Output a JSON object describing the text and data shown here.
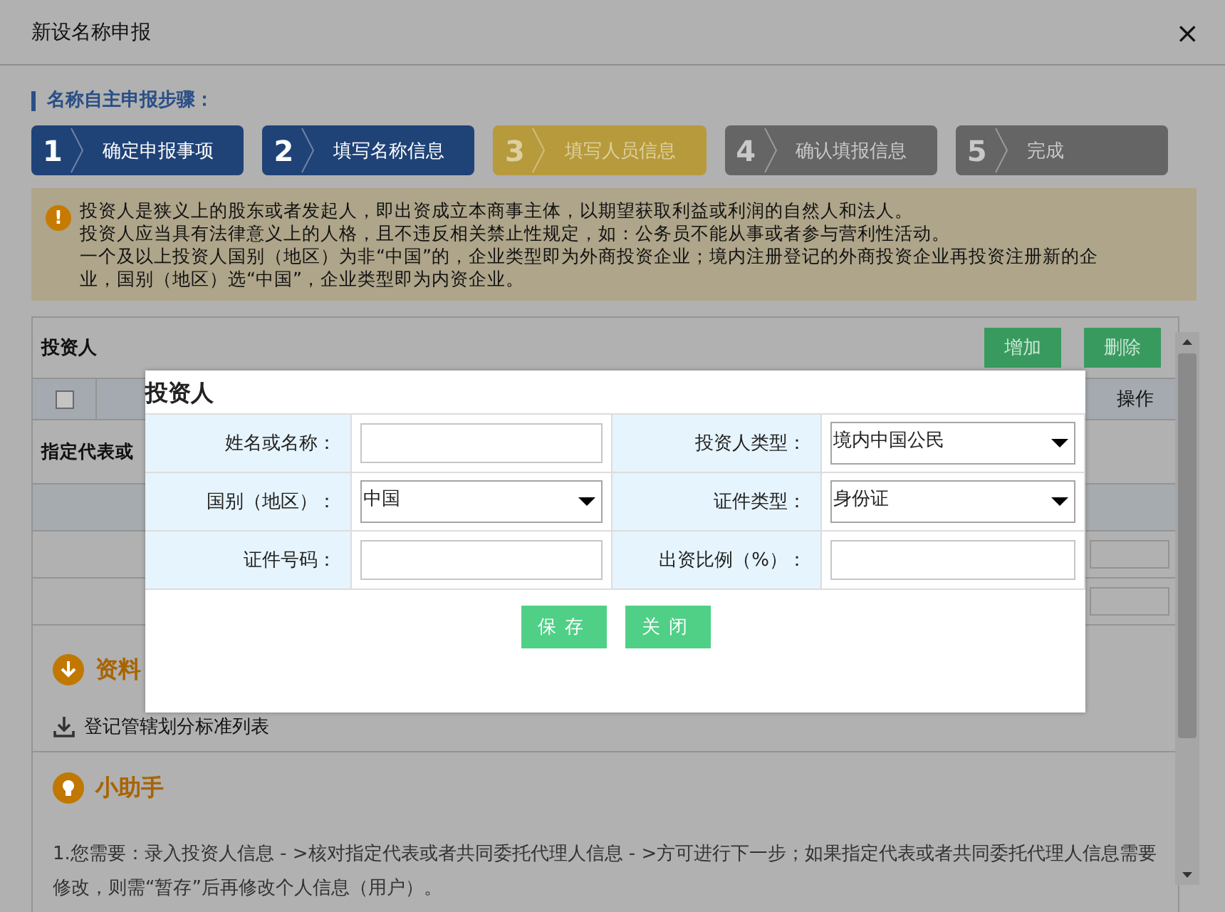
{
  "window": {
    "title": "新设名称申报",
    "close": "×"
  },
  "steps_heading": "名称自主申报步骤：",
  "steps": [
    {
      "number": "1",
      "label": "确定申报事项",
      "kind": "done"
    },
    {
      "number": "2",
      "label": "填写名称信息",
      "kind": "done"
    },
    {
      "number": "3",
      "label": "填写人员信息",
      "kind": "current"
    },
    {
      "number": "4",
      "label": "确认填报信息",
      "kind": "pending"
    },
    {
      "number": "5",
      "label": "完成",
      "kind": "pending"
    }
  ],
  "notice": {
    "icon": "!",
    "paragraphs": [
      "投资人是狭义上的股东或者发起人，即出资成立本商事主体，以期望获取利益或利润的自然人和法人。",
      "投资人应当具有法律意义上的人格，且不违反相关禁止性规定，如：公务员不能从事或者参与营利性活动。",
      "一个及以上投资人国别（地区）为非“中国”的，企业类型即为外商投资企业；境内注册登记的外商投资企业再投资注册新的企业，国别（地区）选“中国”，企业类型即为内资企业。"
    ]
  },
  "investors": {
    "title": "投资人",
    "buttons": [
      "增加",
      "删除"
    ],
    "select_all_checked": false,
    "last_column": "操作",
    "designated_label": "指定代表或"
  },
  "resources": {
    "title": "资料",
    "link": "登记管辖划分标准列表"
  },
  "helper": {
    "title": "小助手",
    "text": "1.您需要：录入投资人信息 - >核对指定代表或者共同委托代理人信息 - >方可进行下一步；如果指定代表或者共同委托代理人信息需要修改，则需“暂存”后再修改个人信息（用户）。"
  },
  "dialog": {
    "title": "投资人",
    "fields": [
      {
        "label": "姓名或名称：",
        "kind": "text"
      },
      {
        "label": "投资人类型：",
        "kind": "select",
        "value": "境内中国公民"
      },
      {
        "label": "国别（地区）：",
        "kind": "select",
        "value": "中国"
      },
      {
        "label": "证件类型：",
        "kind": "select",
        "value": "身份证"
      },
      {
        "label": "证件号码：",
        "kind": "text"
      },
      {
        "label": "出资比例（%）：",
        "kind": "text"
      }
    ],
    "buttons": [
      "保存",
      "关闭"
    ]
  }
}
